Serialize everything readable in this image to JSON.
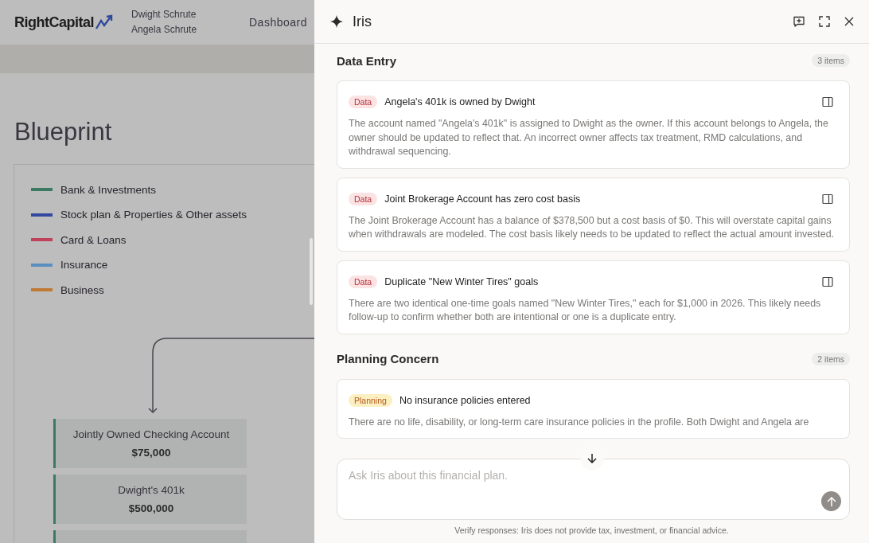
{
  "app": {
    "logo": "RightCapital",
    "clients": [
      "Dwight Schrute",
      "Angela Schrute"
    ],
    "nav": [
      {
        "label": "Dashboard"
      }
    ]
  },
  "blueprint": {
    "title": "Blueprint",
    "legend": [
      {
        "label": "Bank & Investments",
        "color": "#3b7a63"
      },
      {
        "label": "Stock plan & Properties & Other assets",
        "color": "#3448a0"
      },
      {
        "label": "Card & Loans",
        "color": "#c0415a"
      },
      {
        "label": "Insurance",
        "color": "#5a8fc0"
      },
      {
        "label": "Business",
        "color": "#c07a35"
      }
    ],
    "accounts": [
      {
        "name": "Jointly Owned Checking Account",
        "value": "$75,000",
        "color": "#3b7a63"
      },
      {
        "name": "Dwight's 401k",
        "value": "$500,000",
        "color": "#3b7a63"
      },
      {
        "color": "#3b7a63"
      }
    ]
  },
  "panel": {
    "title": "Iris",
    "sections": [
      {
        "title": "Data Entry",
        "count": "3 items",
        "issues": [
          {
            "kind": "data",
            "tag": "Data",
            "title": "Angela's 401k is owned by Dwight",
            "body": "The account named \"Angela's 401k\" is assigned to Dwight as the owner. If this account belongs to Angela, the owner should be updated to reflect that. An incorrect owner affects tax treatment, RMD calculations, and withdrawal sequencing."
          },
          {
            "kind": "data",
            "tag": "Data",
            "title": "Joint Brokerage Account has zero cost basis",
            "body": "The Joint Brokerage Account has a balance of $378,500 but a cost basis of $0. This will overstate capital gains when withdrawals are modeled. The cost basis likely needs to be updated to reflect the actual amount invested."
          },
          {
            "kind": "data",
            "tag": "Data",
            "title": "Duplicate \"New Winter Tires\" goals",
            "body": "There are two identical one-time goals named \"New Winter Tires,\" each for $1,000 in 2026. This likely needs follow-up to confirm whether both are intentional or one is a duplicate entry."
          }
        ]
      },
      {
        "title": "Planning Concern",
        "count": "2 items",
        "issues": [
          {
            "kind": "planning",
            "tag": "Planning",
            "title": "No insurance policies entered",
            "body": "There are no life, disability, or long-term care insurance policies in the profile. Both Dwight and Angela are"
          }
        ]
      }
    ],
    "composer": {
      "placeholder": "Ask Iris about this financial plan."
    },
    "disclaimer": "Verify responses: Iris does not provide tax, investment, or financial advice."
  }
}
